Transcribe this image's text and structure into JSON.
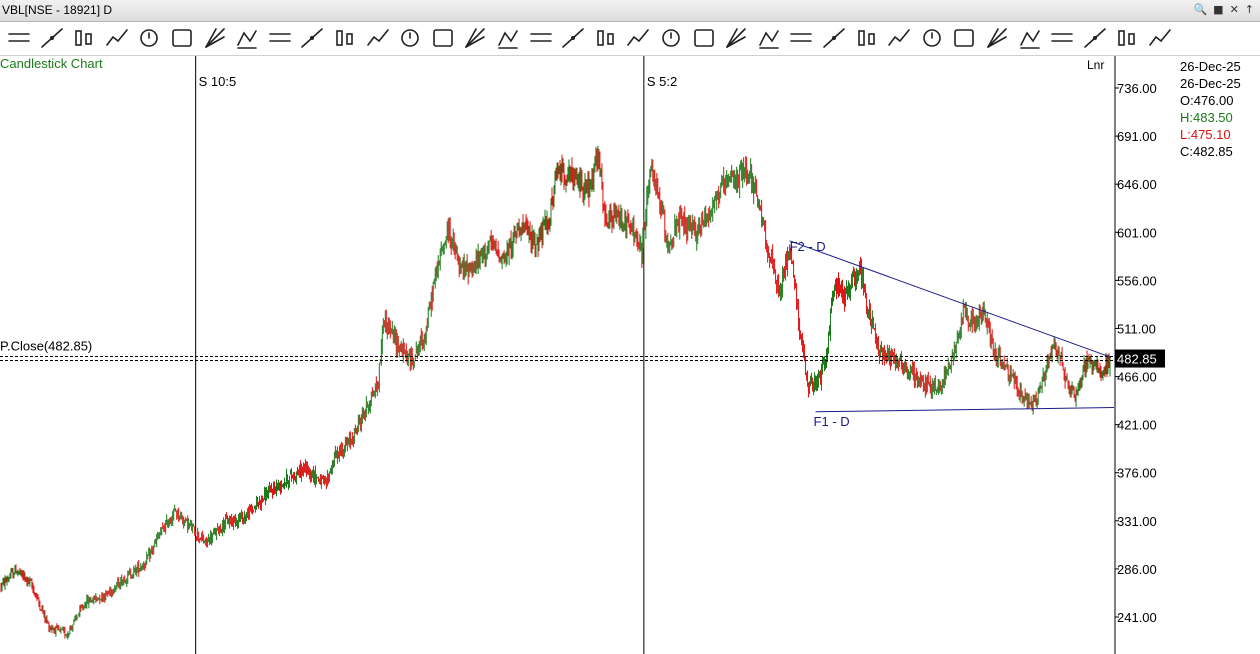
{
  "window": {
    "title": "VBL[NSE - 18921] D"
  },
  "chart_label": "Candlestick Chart",
  "scale_mode": "Lnr",
  "ohlc": {
    "date1": "26-Dec-25",
    "date2": "26-Dec-25",
    "open": "O:476.00",
    "high": "H:483.50",
    "low": "L:475.10",
    "close": "C:482.85"
  },
  "colors": {
    "up": "#1a7a1a",
    "down": "#e01010",
    "trendline": "#1a1a8c",
    "open_text": "#1a7a1a",
    "high_text": "#1a7a1a",
    "low_text": "#e01010",
    "close_text": "#000000"
  },
  "toolbar_icons": [
    "horizontal-lines-icon",
    "horizontal-line-icon",
    "trendline-icon",
    "cycle-icon",
    "cursor-icon",
    "bar-type-icon",
    "volume-icon",
    "candlestick-icon",
    "ruler-icon",
    "scissors-icon",
    "crosshair-icon",
    "rectangle-icon",
    "wave-icon",
    "histogram-icon",
    "scatter-icon",
    "area-chart-icon",
    "candle-color-icon",
    "fan-icon",
    "arc-icon",
    "measure-icon",
    "bar-chart-icon",
    "divider-icon",
    "cube-icon",
    "text-icon",
    "tools-icon",
    "bars-icon",
    "undo-icon",
    "document-edit-icon",
    "eraser-icon",
    "link-icon",
    "book-icon",
    "star-icon",
    "chart-add-icon",
    "compare-icon",
    "brush-icon",
    "bell-icon"
  ],
  "chart_data": {
    "type": "candlestick",
    "title": "",
    "xlabel": "",
    "ylabel": "",
    "ylim": [
      195,
      760
    ],
    "y_ticks": [
      "736.00",
      "691.00",
      "646.00",
      "601.00",
      "556.00",
      "511.00",
      "466.00",
      "421.00",
      "376.00",
      "331.00",
      "286.00",
      "241.00"
    ],
    "y_tick_values": [
      736,
      691,
      646,
      601,
      556,
      511,
      466,
      421,
      376,
      331,
      286,
      241
    ],
    "grid": false,
    "previous_close": {
      "label": "P.Close(482.85)",
      "value": 482.85,
      "badge": "482.85"
    },
    "session_markers": [
      {
        "label": "S 10:5",
        "bar_index": 195
      },
      {
        "label": "S 5:2",
        "bar_index": 644
      }
    ],
    "pattern_labels": [
      {
        "label": "F2 - D",
        "bar_index": 790,
        "value": 593
      },
      {
        "label": "F1 - D",
        "bar_index": 814,
        "value": 433
      }
    ],
    "trendlines": [
      {
        "name": "upper",
        "from": {
          "bar_index": 790,
          "value": 593
        },
        "to": {
          "bar_index": 1112,
          "value": 484
        }
      },
      {
        "name": "lower",
        "from": {
          "bar_index": 816,
          "value": 433
        },
        "to": {
          "bar_index": 1115,
          "value": 437
        }
      }
    ],
    "bar_count": 1112,
    "price_path": [
      [
        0,
        270
      ],
      [
        15,
        285
      ],
      [
        30,
        272
      ],
      [
        48,
        232
      ],
      [
        66,
        225
      ],
      [
        85,
        255
      ],
      [
        105,
        262
      ],
      [
        125,
        278
      ],
      [
        145,
        292
      ],
      [
        160,
        320
      ],
      [
        175,
        340
      ],
      [
        195,
        320
      ],
      [
        205,
        310
      ],
      [
        225,
        330
      ],
      [
        245,
        335
      ],
      [
        265,
        355
      ],
      [
        290,
        372
      ],
      [
        305,
        380
      ],
      [
        325,
        365
      ],
      [
        335,
        392
      ],
      [
        350,
        405
      ],
      [
        365,
        435
      ],
      [
        378,
        460
      ],
      [
        383,
        520
      ],
      [
        395,
        500
      ],
      [
        410,
        480
      ],
      [
        425,
        505
      ],
      [
        435,
        560
      ],
      [
        448,
        605
      ],
      [
        460,
        565
      ],
      [
        475,
        570
      ],
      [
        490,
        590
      ],
      [
        505,
        575
      ],
      [
        520,
        610
      ],
      [
        535,
        590
      ],
      [
        548,
        610
      ],
      [
        558,
        660
      ],
      [
        575,
        650
      ],
      [
        590,
        640
      ],
      [
        598,
        675
      ],
      [
        605,
        610
      ],
      [
        620,
        615
      ],
      [
        635,
        600
      ],
      [
        642,
        580
      ],
      [
        650,
        660
      ],
      [
        660,
        630
      ],
      [
        668,
        590
      ],
      [
        680,
        610
      ],
      [
        695,
        600
      ],
      [
        710,
        620
      ],
      [
        720,
        640
      ],
      [
        735,
        650
      ],
      [
        750,
        660
      ],
      [
        760,
        620
      ],
      [
        770,
        580
      ],
      [
        780,
        540
      ],
      [
        790,
        590
      ],
      [
        798,
        530
      ],
      [
        808,
        455
      ],
      [
        818,
        460
      ],
      [
        826,
        480
      ],
      [
        835,
        555
      ],
      [
        845,
        540
      ],
      [
        860,
        570
      ],
      [
        868,
        530
      ],
      [
        880,
        490
      ],
      [
        895,
        485
      ],
      [
        910,
        470
      ],
      [
        925,
        460
      ],
      [
        940,
        455
      ],
      [
        952,
        480
      ],
      [
        965,
        530
      ],
      [
        975,
        515
      ],
      [
        985,
        525
      ],
      [
        995,
        490
      ],
      [
        1005,
        475
      ],
      [
        1015,
        460
      ],
      [
        1025,
        445
      ],
      [
        1035,
        440
      ],
      [
        1045,
        465
      ],
      [
        1055,
        500
      ],
      [
        1062,
        480
      ],
      [
        1070,
        455
      ],
      [
        1078,
        450
      ],
      [
        1085,
        475
      ],
      [
        1095,
        480
      ],
      [
        1104,
        470
      ],
      [
        1112,
        482.85
      ]
    ]
  }
}
